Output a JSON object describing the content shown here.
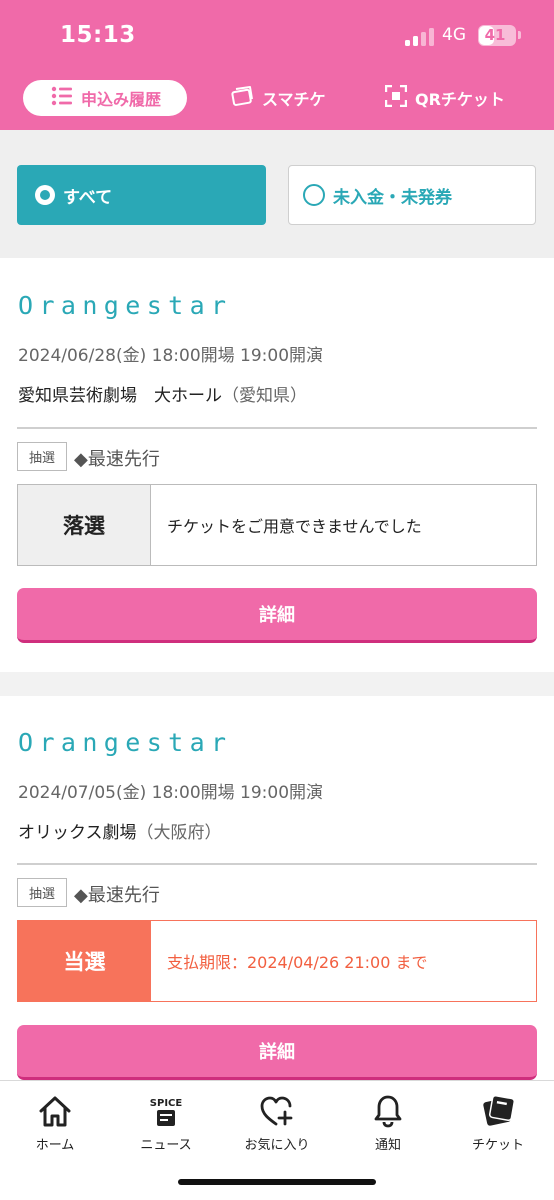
{
  "status_bar": {
    "time": "15:13",
    "network": "4G",
    "battery": "41",
    "battery_level_percent": 41
  },
  "top_tabs": [
    {
      "label": "申込み履歴",
      "icon": "list-icon",
      "active": true
    },
    {
      "label": "スマチケ",
      "icon": "smart-ticket-icon",
      "active": false
    },
    {
      "label": "QRチケット",
      "icon": "qr-scan-icon",
      "active": false
    }
  ],
  "filters": [
    {
      "label": "すべて",
      "selected": true
    },
    {
      "label": "未入金・未発券",
      "selected": false
    }
  ],
  "applications": [
    {
      "title": "Orangestar",
      "date": "2024/06/28(金) 18:00開場 19:00開演",
      "venue": "愛知県芸術劇場　大ホール",
      "prefecture": "（愛知県）",
      "lottery_badge": "抽選",
      "lottery_name": "◆最速先行",
      "result_label": "落選",
      "result_message": "チケットをご用意できませんでした",
      "detail_label": "詳細"
    },
    {
      "title": "Orangestar",
      "date": "2024/07/05(金) 18:00開場 19:00開演",
      "venue": "オリックス劇場",
      "prefecture": "（大阪府）",
      "lottery_badge": "抽選",
      "lottery_name": "◆最速先行",
      "result_label": "当選",
      "result_message": "支払期限：2024/04/26 21:00 まで",
      "detail_label": "詳細"
    }
  ],
  "bottom_nav": [
    {
      "label": "ホーム",
      "icon": "home-icon"
    },
    {
      "label": "ニュース",
      "icon": "spice-news-icon",
      "icon_text": "SPICE"
    },
    {
      "label": "お気に入り",
      "icon": "heart-plus-icon"
    },
    {
      "label": "通知",
      "icon": "bell-icon"
    },
    {
      "label": "チケット",
      "icon": "ticket-icon"
    }
  ],
  "colors": {
    "brand_pink": "#f06aa9",
    "teal": "#2aa8b6",
    "win_orange": "#f7735b",
    "detail_button_shadow": "#cf2e7d"
  }
}
